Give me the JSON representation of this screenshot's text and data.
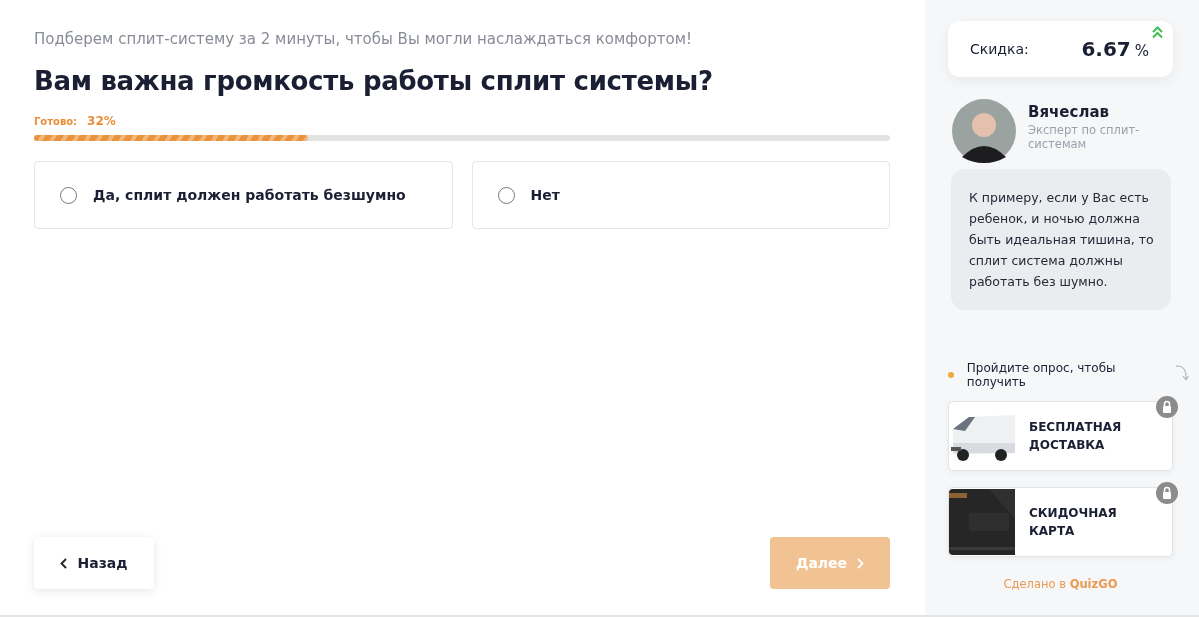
{
  "quiz": {
    "intro": "Подберем сплит-систему за 2 минуты, чтобы Вы могли наслаждаться комфортом!",
    "question": "Вам важна громкость работы сплит системы?",
    "progress": {
      "label": "Готово:",
      "value": "32%",
      "level": 0.32
    },
    "options": [
      {
        "label": "Да, сплит должен работать безшумно",
        "selected": false
      },
      {
        "label": "Нет",
        "selected": false
      }
    ],
    "back_button": "Назад",
    "next_button": {
      "label": "Далее",
      "disabled": true
    }
  },
  "sidebar": {
    "discount": {
      "label": "Скидка:",
      "value": "6.67",
      "unit": "%"
    },
    "expert": {
      "name": "Вячеслав",
      "role": "Эксперт по сплит-системам",
      "tip": "К примеру, если у Вас есть ребенок, и ночью должна быть идеальная тишина, то сплит система должны работать без шумно."
    },
    "bonus_hint": "Пройдите опрос, чтобы получить",
    "bonuses": [
      {
        "title": "БЕСПЛАТНАЯ ДОСТАВКА",
        "kind": "van",
        "locked": true
      },
      {
        "title": "СКИДОЧНАЯ КАРТА",
        "kind": "card",
        "locked": true
      }
    ],
    "credit": {
      "text": "Сделано в",
      "brand": "QuizGO"
    }
  }
}
